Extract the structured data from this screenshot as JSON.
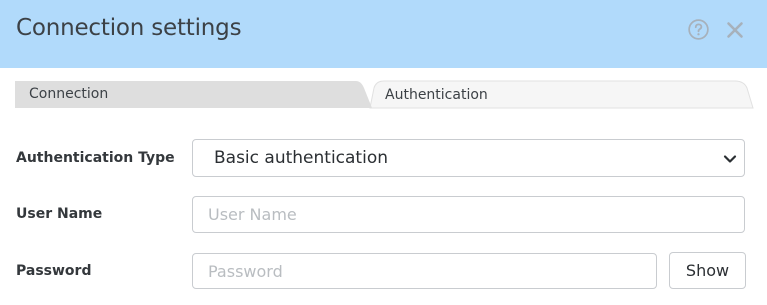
{
  "dialog": {
    "title": "Connection settings",
    "help_icon": "question-circle-icon",
    "close_icon": "close-x-icon"
  },
  "tabs": [
    {
      "label": "Connection",
      "active": false
    },
    {
      "label": "Authentication",
      "active": true
    }
  ],
  "form": {
    "auth_type": {
      "label": "Authentication Type",
      "value": "Basic authentication"
    },
    "user_name": {
      "label": "User Name",
      "value": "",
      "placeholder": "User Name"
    },
    "password": {
      "label": "Password",
      "value": "",
      "placeholder": "Password",
      "show_label": "Show"
    }
  },
  "colors": {
    "header_bg": "#b1dafb",
    "inactive_tab_bg": "#dedede",
    "active_tab_bg": "#f6f6f6",
    "icon_gray": "#a7b1bb"
  }
}
